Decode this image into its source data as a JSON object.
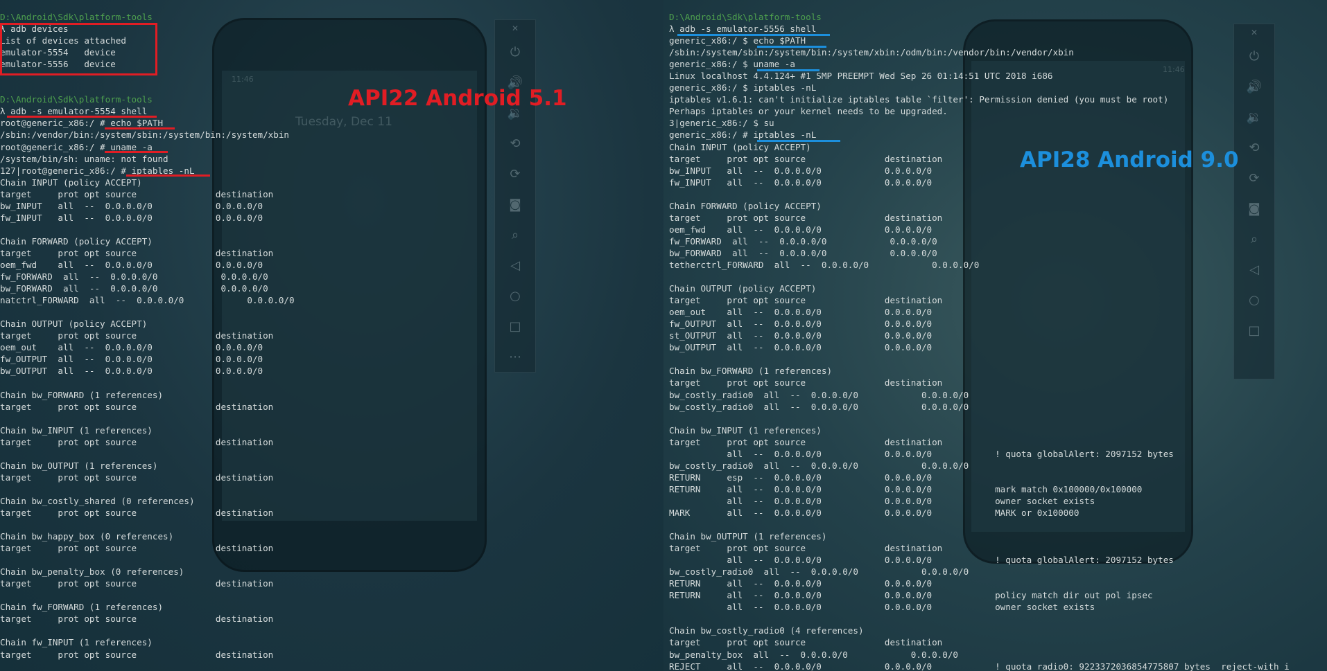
{
  "left": {
    "api_label": "API22 Android 5.1",
    "label_color": "#e11d24",
    "phone_overlay": {
      "clock": "Tuesday, Dec 11",
      "time": "11:46"
    },
    "lines": [
      {
        "t": "D:\\Android\\Sdk\\platform-tools",
        "c": "path"
      },
      {
        "t": "λ adb devices"
      },
      {
        "t": "List of devices attached"
      },
      {
        "t": "emulator-5554   device"
      },
      {
        "t": "emulator-5556   device"
      },
      {
        "t": ""
      },
      {
        "t": ""
      },
      {
        "t": "D:\\Android\\Sdk\\platform-tools",
        "c": "path"
      },
      {
        "t": "λ adb -s emulator-5554 shell"
      },
      {
        "t": "root@generic_x86:/ # echo $PATH"
      },
      {
        "t": "/sbin:/vendor/bin:/system/sbin:/system/bin:/system/xbin"
      },
      {
        "t": "root@generic_x86:/ # uname -a"
      },
      {
        "t": "/system/bin/sh: uname: not found"
      },
      {
        "t": "127|root@generic_x86:/ # iptables -nL"
      },
      {
        "t": "Chain INPUT (policy ACCEPT)"
      },
      {
        "t": "target     prot opt source               destination"
      },
      {
        "t": "bw_INPUT   all  --  0.0.0.0/0            0.0.0.0/0"
      },
      {
        "t": "fw_INPUT   all  --  0.0.0.0/0            0.0.0.0/0"
      },
      {
        "t": ""
      },
      {
        "t": "Chain FORWARD (policy ACCEPT)"
      },
      {
        "t": "target     prot opt source               destination"
      },
      {
        "t": "oem_fwd    all  --  0.0.0.0/0            0.0.0.0/0"
      },
      {
        "t": "fw_FORWARD  all  --  0.0.0.0/0            0.0.0.0/0"
      },
      {
        "t": "bw_FORWARD  all  --  0.0.0.0/0            0.0.0.0/0"
      },
      {
        "t": "natctrl_FORWARD  all  --  0.0.0.0/0            0.0.0.0/0"
      },
      {
        "t": ""
      },
      {
        "t": "Chain OUTPUT (policy ACCEPT)"
      },
      {
        "t": "target     prot opt source               destination"
      },
      {
        "t": "oem_out    all  --  0.0.0.0/0            0.0.0.0/0"
      },
      {
        "t": "fw_OUTPUT  all  --  0.0.0.0/0            0.0.0.0/0"
      },
      {
        "t": "bw_OUTPUT  all  --  0.0.0.0/0            0.0.0.0/0"
      },
      {
        "t": ""
      },
      {
        "t": "Chain bw_FORWARD (1 references)"
      },
      {
        "t": "target     prot opt source               destination"
      },
      {
        "t": ""
      },
      {
        "t": "Chain bw_INPUT (1 references)"
      },
      {
        "t": "target     prot opt source               destination"
      },
      {
        "t": ""
      },
      {
        "t": "Chain bw_OUTPUT (1 references)"
      },
      {
        "t": "target     prot opt source               destination"
      },
      {
        "t": ""
      },
      {
        "t": "Chain bw_costly_shared (0 references)"
      },
      {
        "t": "target     prot opt source               destination"
      },
      {
        "t": ""
      },
      {
        "t": "Chain bw_happy_box (0 references)"
      },
      {
        "t": "target     prot opt source               destination"
      },
      {
        "t": ""
      },
      {
        "t": "Chain bw_penalty_box (0 references)"
      },
      {
        "t": "target     prot opt source               destination"
      },
      {
        "t": ""
      },
      {
        "t": "Chain fw_FORWARD (1 references)"
      },
      {
        "t": "target     prot opt source               destination"
      },
      {
        "t": ""
      },
      {
        "t": "Chain fw_INPUT (1 references)"
      },
      {
        "t": "target     prot opt source               destination"
      }
    ]
  },
  "right": {
    "api_label": "API28 Android 9.0",
    "label_color": "#1c8fdc",
    "phone_overlay": {
      "time": "11:46"
    },
    "lines": [
      {
        "t": "D:\\Android\\Sdk\\platform-tools",
        "c": "path"
      },
      {
        "t": "λ adb -s emulator-5556 shell"
      },
      {
        "t": "generic_x86:/ $ echo $PATH"
      },
      {
        "t": "/sbin:/system/sbin:/system/bin:/system/xbin:/odm/bin:/vendor/bin:/vendor/xbin"
      },
      {
        "t": "generic_x86:/ $ uname -a"
      },
      {
        "t": "Linux localhost 4.4.124+ #1 SMP PREEMPT Wed Sep 26 01:14:51 UTC 2018 i686"
      },
      {
        "t": "generic_x86:/ $ iptables -nL"
      },
      {
        "t": "iptables v1.6.1: can't initialize iptables table `filter': Permission denied (you must be root)"
      },
      {
        "t": "Perhaps iptables or your kernel needs to be upgraded."
      },
      {
        "t": "3|generic_x86:/ $ su"
      },
      {
        "t": "generic_x86:/ # iptables -nL"
      },
      {
        "t": "Chain INPUT (policy ACCEPT)"
      },
      {
        "t": "target     prot opt source               destination"
      },
      {
        "t": "bw_INPUT   all  --  0.0.0.0/0            0.0.0.0/0"
      },
      {
        "t": "fw_INPUT   all  --  0.0.0.0/0            0.0.0.0/0"
      },
      {
        "t": ""
      },
      {
        "t": "Chain FORWARD (policy ACCEPT)"
      },
      {
        "t": "target     prot opt source               destination"
      },
      {
        "t": "oem_fwd    all  --  0.0.0.0/0            0.0.0.0/0"
      },
      {
        "t": "fw_FORWARD  all  --  0.0.0.0/0            0.0.0.0/0"
      },
      {
        "t": "bw_FORWARD  all  --  0.0.0.0/0            0.0.0.0/0"
      },
      {
        "t": "tetherctrl_FORWARD  all  --  0.0.0.0/0            0.0.0.0/0"
      },
      {
        "t": ""
      },
      {
        "t": "Chain OUTPUT (policy ACCEPT)"
      },
      {
        "t": "target     prot opt source               destination"
      },
      {
        "t": "oem_out    all  --  0.0.0.0/0            0.0.0.0/0"
      },
      {
        "t": "fw_OUTPUT  all  --  0.0.0.0/0            0.0.0.0/0"
      },
      {
        "t": "st_OUTPUT  all  --  0.0.0.0/0            0.0.0.0/0"
      },
      {
        "t": "bw_OUTPUT  all  --  0.0.0.0/0            0.0.0.0/0"
      },
      {
        "t": ""
      },
      {
        "t": "Chain bw_FORWARD (1 references)"
      },
      {
        "t": "target     prot opt source               destination"
      },
      {
        "t": "bw_costly_radio0  all  --  0.0.0.0/0            0.0.0.0/0"
      },
      {
        "t": "bw_costly_radio0  all  --  0.0.0.0/0            0.0.0.0/0"
      },
      {
        "t": ""
      },
      {
        "t": "Chain bw_INPUT (1 references)"
      },
      {
        "t": "target     prot opt source               destination"
      },
      {
        "t": "           all  --  0.0.0.0/0            0.0.0.0/0            ! quota globalAlert: 2097152 bytes"
      },
      {
        "t": "bw_costly_radio0  all  --  0.0.0.0/0            0.0.0.0/0"
      },
      {
        "t": "RETURN     esp  --  0.0.0.0/0            0.0.0.0/0"
      },
      {
        "t": "RETURN     all  --  0.0.0.0/0            0.0.0.0/0            mark match 0x100000/0x100000"
      },
      {
        "t": "           all  --  0.0.0.0/0            0.0.0.0/0            owner socket exists"
      },
      {
        "t": "MARK       all  --  0.0.0.0/0            0.0.0.0/0            MARK or 0x100000"
      },
      {
        "t": ""
      },
      {
        "t": "Chain bw_OUTPUT (1 references)"
      },
      {
        "t": "target     prot opt source               destination"
      },
      {
        "t": "           all  --  0.0.0.0/0            0.0.0.0/0            ! quota globalAlert: 2097152 bytes"
      },
      {
        "t": "bw_costly_radio0  all  --  0.0.0.0/0            0.0.0.0/0"
      },
      {
        "t": "RETURN     all  --  0.0.0.0/0            0.0.0.0/0"
      },
      {
        "t": "RETURN     all  --  0.0.0.0/0            0.0.0.0/0            policy match dir out pol ipsec"
      },
      {
        "t": "           all  --  0.0.0.0/0            0.0.0.0/0            owner socket exists"
      },
      {
        "t": ""
      },
      {
        "t": "Chain bw_costly_radio0 (4 references)"
      },
      {
        "t": "target     prot opt source               destination"
      },
      {
        "t": "bw_penalty_box  all  --  0.0.0.0/0            0.0.0.0/0"
      },
      {
        "t": "REJECT     all  --  0.0.0.0/0            0.0.0.0/0            ! quota radio0: 9223372036854775807 bytes  reject-with i"
      }
    ]
  },
  "icons": [
    "close-icon",
    "power-icon",
    "volume-up-icon",
    "volume-down-icon",
    "rotate-left-icon",
    "rotate-right-icon",
    "camera-icon",
    "zoom-icon",
    "back-icon",
    "home-icon",
    "overview-icon",
    "more-icon"
  ]
}
